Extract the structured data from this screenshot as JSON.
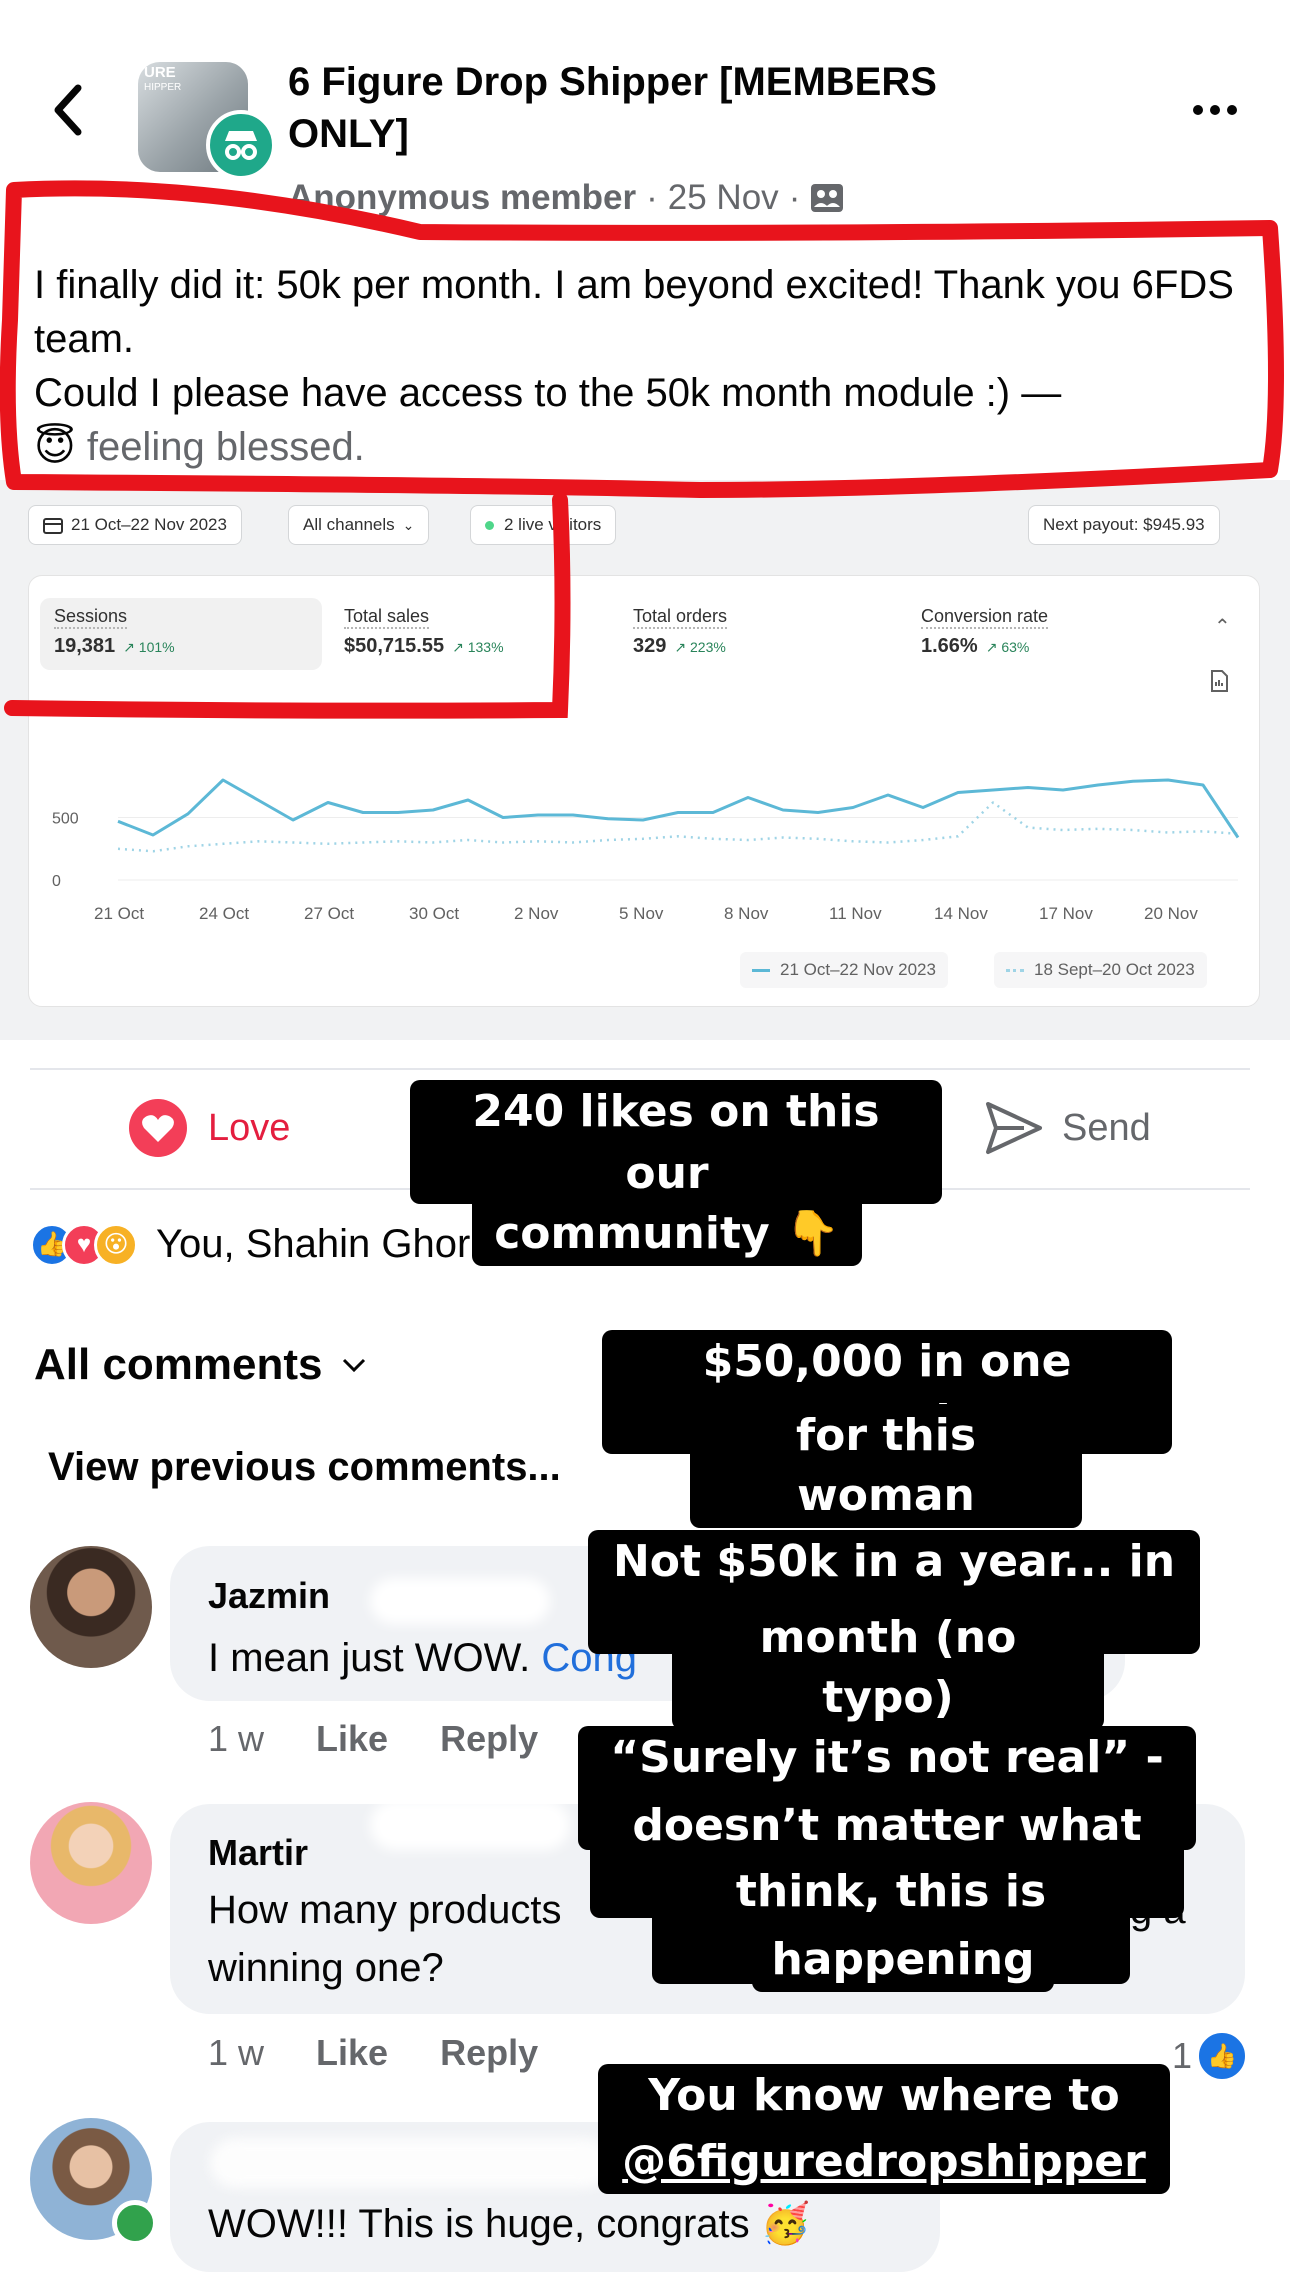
{
  "header": {
    "group_name": "6 Figure Drop Shipper [MEMBERS ONLY]",
    "group_avatar_text": "URE",
    "group_avatar_subtext": "HIPPER",
    "author": "Anonymous member",
    "separator": "·",
    "date": "25 Nov",
    "audience_icon": "group-members-icon"
  },
  "post": {
    "line1": "I finally did it: 50k per month. I am beyond excited! Thank you 6FDS team.",
    "line2": "Could I please have access to the 50k month module :) —",
    "feeling_emoji": "😇",
    "feeling": "feeling blessed."
  },
  "dashboard": {
    "date_range": "21 Oct–22 Nov 2023",
    "channels": "All channels",
    "live_visitors": "2 live visitors",
    "next_payout": "Next payout: $945.93",
    "metrics": [
      {
        "label": "Sessions",
        "value": "19,381",
        "delta": "↗ 101%"
      },
      {
        "label": "Total sales",
        "value": "$50,715.55",
        "delta": "↗ 133%"
      },
      {
        "label": "Total orders",
        "value": "329",
        "delta": "↗ 223%"
      },
      {
        "label": "Conversion rate",
        "value": "1.66%",
        "delta": "↗ 63%"
      }
    ],
    "legend": {
      "current": "21 Oct–22 Nov 2023",
      "previous": "18 Sept–20 Oct 2023"
    }
  },
  "chart_data": {
    "type": "line",
    "x": [
      "21 Oct",
      "22 Oct",
      "23 Oct",
      "24 Oct",
      "25 Oct",
      "26 Oct",
      "27 Oct",
      "28 Oct",
      "29 Oct",
      "30 Oct",
      "31 Oct",
      "1 Nov",
      "2 Nov",
      "3 Nov",
      "4 Nov",
      "5 Nov",
      "6 Nov",
      "7 Nov",
      "8 Nov",
      "9 Nov",
      "10 Nov",
      "11 Nov",
      "12 Nov",
      "13 Nov",
      "14 Nov",
      "15 Nov",
      "16 Nov",
      "17 Nov",
      "18 Nov",
      "19 Nov",
      "20 Nov",
      "21 Nov",
      "22 Nov"
    ],
    "x_tick_labels": [
      "21 Oct",
      "24 Oct",
      "27 Oct",
      "30 Oct",
      "2 Nov",
      "5 Nov",
      "8 Nov",
      "11 Nov",
      "14 Nov",
      "17 Nov",
      "20 Nov"
    ],
    "y_tick_labels": [
      "500",
      "0"
    ],
    "ylim": [
      0,
      1200
    ],
    "series": [
      {
        "name": "21 Oct–22 Nov 2023",
        "style": "solid",
        "color": "#5cb8d6",
        "values": [
          470,
          360,
          530,
          800,
          640,
          480,
          620,
          540,
          540,
          560,
          640,
          500,
          520,
          520,
          490,
          480,
          540,
          540,
          660,
          560,
          540,
          580,
          680,
          580,
          700,
          720,
          740,
          720,
          760,
          790,
          800,
          760,
          340
        ]
      },
      {
        "name": "18 Sept–20 Oct 2023",
        "style": "dotted",
        "color": "#9fd4e6",
        "values": [
          250,
          230,
          270,
          290,
          310,
          300,
          290,
          300,
          310,
          300,
          320,
          300,
          310,
          300,
          320,
          330,
          350,
          330,
          320,
          340,
          330,
          310,
          300,
          320,
          350,
          620,
          420,
          400,
          410,
          400,
          380,
          390,
          370
        ]
      }
    ]
  },
  "actions": {
    "love": "Love",
    "send": "Send",
    "reactions_text": "You, Shahin Ghorbani and 240 others"
  },
  "comments_section": {
    "filter": "All comments",
    "view_previous": "View previous comments..."
  },
  "comments": [
    {
      "name": "Jazmin",
      "text": "I mean just WOW.",
      "link_text": "Cong",
      "time": "1 w",
      "like": "Like",
      "reply": "Reply"
    },
    {
      "name": "Martir",
      "text_line1": "How many products",
      "text_tail": "g a",
      "text_line2": "winning one?",
      "time": "1 w",
      "like": "Like",
      "reply": "Reply",
      "reaction_count": "1"
    },
    {
      "text": "WOW!!! This is huge, congrats",
      "emoji": "🥳"
    }
  ],
  "stickers": {
    "likes": [
      "240 likes on this post in",
      "our community 👇"
    ],
    "amount": [
      "$50,000 in one month",
      "for this woman"
    ],
    "notyear": [
      "Not $50k in a year... in a",
      "month (no typo)"
    ],
    "surely": [
      "“Surely it’s not real” - it",
      "doesn’t matter what you",
      "think, this is what’s",
      "happening"
    ],
    "cta": [
      "You know where to go |",
      "@6figuredropshipper"
    ]
  }
}
